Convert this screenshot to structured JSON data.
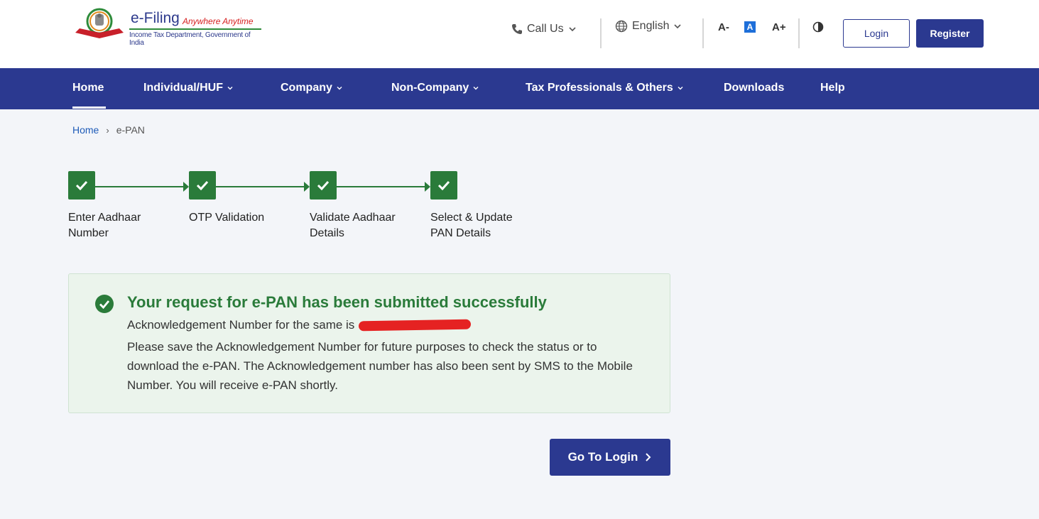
{
  "logo": {
    "title": "e-Filing",
    "tagline": "Anywhere Anytime",
    "subtitle": "Income Tax Department, Government of India",
    "seal_text": "INCOME TAX DEPARTMENT"
  },
  "header": {
    "call_us": "Call Us",
    "language": "English",
    "font_decrease": "A-",
    "font_normal": "A",
    "font_increase": "A+",
    "login": "Login",
    "register": "Register"
  },
  "nav": {
    "items": [
      {
        "label": "Home",
        "active": true,
        "dropdown": false
      },
      {
        "label": "Individual/HUF",
        "dropdown": true
      },
      {
        "label": "Company",
        "dropdown": true
      },
      {
        "label": "Non-Company",
        "dropdown": true
      },
      {
        "label": "Tax Professionals & Others",
        "dropdown": true
      },
      {
        "label": "Downloads",
        "dropdown": false
      },
      {
        "label": "Help",
        "dropdown": false
      }
    ]
  },
  "breadcrumb": {
    "home": "Home",
    "separator": "›",
    "current": "e-PAN"
  },
  "steps": [
    {
      "line1": "Enter Aadhaar",
      "line2": "Number",
      "status": "completed"
    },
    {
      "line1": "OTP Validation",
      "line2": "",
      "status": "completed"
    },
    {
      "line1": "Validate Aadhaar",
      "line2": "Details",
      "status": "completed"
    },
    {
      "line1": "Select & Update",
      "line2": "PAN Details",
      "status": "completed"
    }
  ],
  "success": {
    "title": "Your request for e-PAN has been submitted successfully",
    "ack_prefix": "Acknowledgement Number for the same is",
    "body": "Please save the Acknowledgement Number for future purposes to check the status or to download the e-PAN. The Acknowledgement number has also been sent by SMS to the Mobile Number. You will receive e-PAN shortly."
  },
  "cta": {
    "label": "Go To Login"
  },
  "colors": {
    "brand": "#2b3990",
    "success": "#2a7b3a",
    "success_bg": "#ebf4ec",
    "link": "#1e5bb8"
  }
}
